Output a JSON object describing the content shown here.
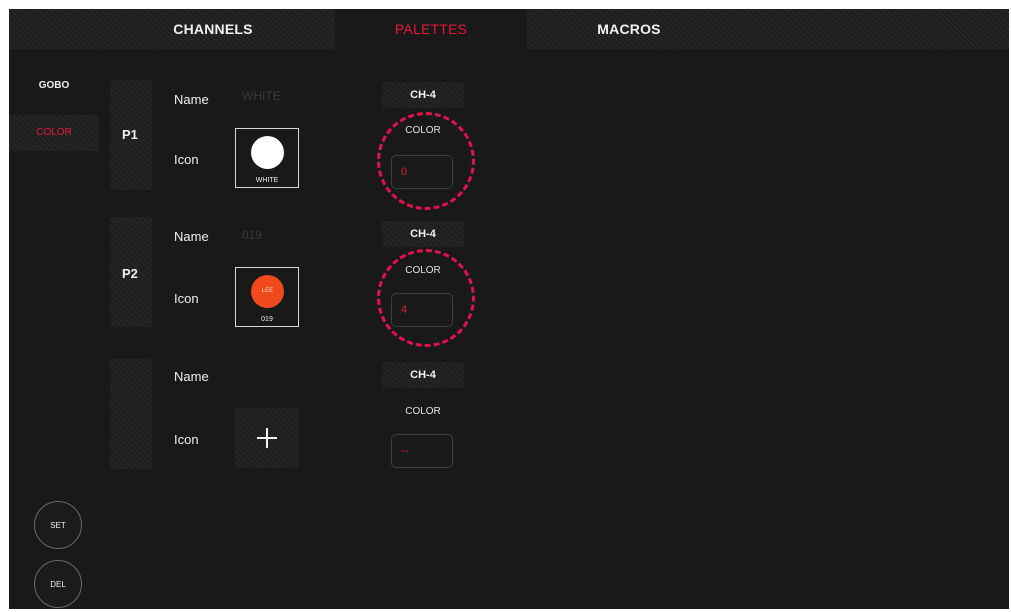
{
  "tabs": [
    {
      "label": "CHANNELS",
      "active": false
    },
    {
      "label": "PALETTES",
      "active": true
    },
    {
      "label": "MACROS",
      "active": false
    }
  ],
  "sidebar": {
    "items": [
      {
        "label": "GOBO",
        "active": false
      },
      {
        "label": "COLOR",
        "active": true
      }
    ],
    "set_label": "SET",
    "del_label": "DEL"
  },
  "labels": {
    "name": "Name",
    "icon": "Icon"
  },
  "palettes": [
    {
      "id": "P1",
      "name_value": "WHITE",
      "icon": {
        "type": "color-swatch",
        "color": "#ffffff",
        "caption": "WHITE",
        "inner_text": ""
      },
      "channel": "CH-4",
      "attribute": "COLOR",
      "value": "0"
    },
    {
      "id": "P2",
      "name_value": "019",
      "icon": {
        "type": "color-swatch",
        "color": "#f04a1c",
        "caption": "019",
        "inner_text": "LEE"
      },
      "channel": "CH-4",
      "attribute": "COLOR",
      "value": "4"
    },
    {
      "id": "",
      "name_value": "",
      "icon": {
        "type": "plus-icon"
      },
      "channel": "CH-4",
      "attribute": "COLOR",
      "value": "--"
    }
  ],
  "colors": {
    "accent": "#e8173c",
    "highlight_ring": "#e3114d",
    "background": "#191919"
  }
}
